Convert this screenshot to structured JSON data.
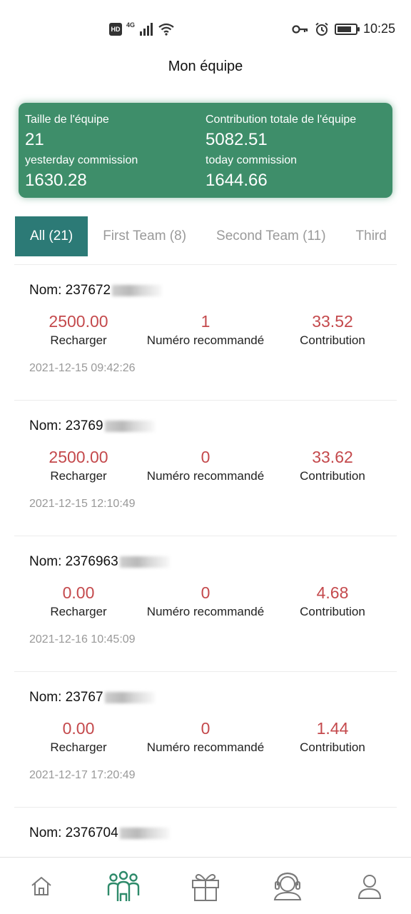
{
  "status_bar": {
    "hd": "HD",
    "network": "4G",
    "time": "10:25",
    "battery_level": 0.8
  },
  "header": {
    "title": "Mon équipe"
  },
  "summary": {
    "team_size_label": "Taille de l'équipe",
    "team_size": "21",
    "total_contribution_label": "Contribution totale de l'équipe",
    "total_contribution": "5082.51",
    "yesterday_label": "yesterday commission",
    "yesterday_value": "1630.28",
    "today_label": "today commission",
    "today_value": "1644.66"
  },
  "tabs": [
    {
      "label": "All (21)",
      "active": true
    },
    {
      "label": "First Team (8)",
      "active": false
    },
    {
      "label": "Second Team (11)",
      "active": false
    },
    {
      "label": "Third",
      "active": false
    }
  ],
  "member_labels": {
    "recharge": "Recharger",
    "referred": "Numéro recommandé",
    "contribution": "Contribution"
  },
  "members": [
    {
      "name": "Nom: 237672",
      "recharge": "2500.00",
      "referred": "1",
      "contribution": "33.52",
      "time": "2021-12-15 09:42:26"
    },
    {
      "name": "Nom: 23769",
      "recharge": "2500.00",
      "referred": "0",
      "contribution": "33.62",
      "time": "2021-12-15 12:10:49"
    },
    {
      "name": "Nom: 2376963",
      "recharge": "0.00",
      "referred": "0",
      "contribution": "4.68",
      "time": "2021-12-16 10:45:09"
    },
    {
      "name": "Nom: 23767",
      "recharge": "0.00",
      "referred": "0",
      "contribution": "1.44",
      "time": "2021-12-17 17:20:49"
    },
    {
      "name": "Nom: 2376704",
      "recharge": "",
      "referred": "",
      "contribution": "",
      "time": ""
    }
  ],
  "nav": [
    {
      "icon": "home-icon",
      "active": false
    },
    {
      "icon": "team-icon",
      "active": true
    },
    {
      "icon": "gift-icon",
      "active": false
    },
    {
      "icon": "support-icon",
      "active": false
    },
    {
      "icon": "user-icon",
      "active": false
    }
  ],
  "colors": {
    "accent": "#3e8e6a",
    "tab_active": "#2c7a76",
    "value_red": "#c4494c",
    "muted": "#999999"
  }
}
